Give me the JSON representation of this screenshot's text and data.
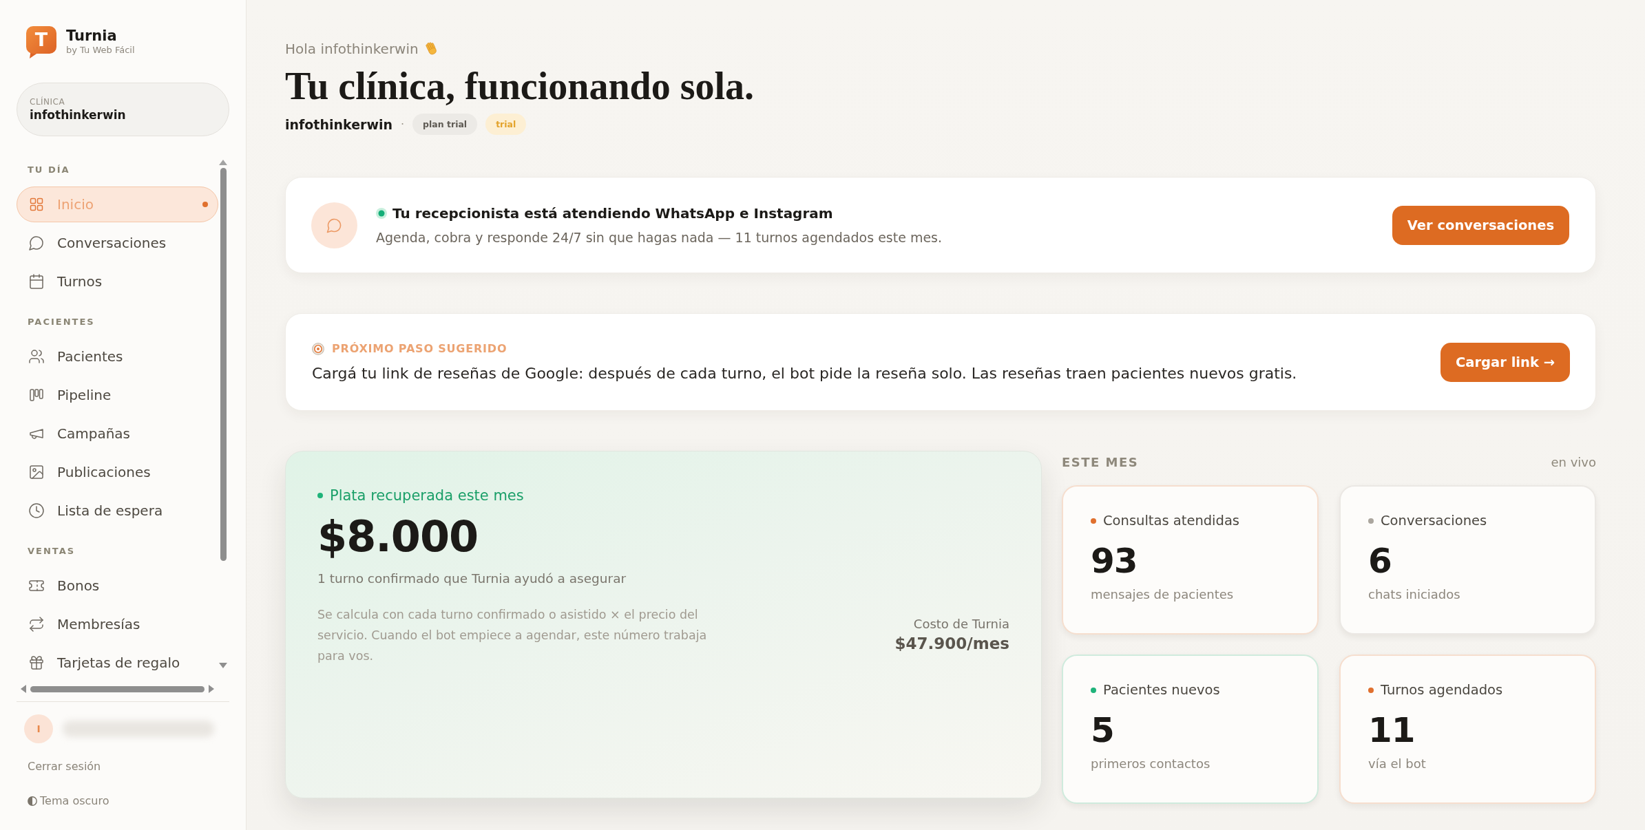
{
  "sidebar": {
    "brand": {
      "logo_letter": "T",
      "name": "Turnia",
      "tagline": "by Tu Web Fácil"
    },
    "clinic": {
      "label": "CLÍNICA",
      "name": "infothinkerwin"
    },
    "sections": [
      {
        "title": "TU DÍA",
        "items": [
          {
            "label": "Inicio",
            "selected": true
          },
          {
            "label": "Conversaciones",
            "selected": false
          },
          {
            "label": "Turnos",
            "selected": false
          }
        ]
      },
      {
        "title": "PACIENTES",
        "items": [
          {
            "label": "Pacientes",
            "selected": false
          },
          {
            "label": "Pipeline",
            "selected": false
          },
          {
            "label": "Campañas",
            "selected": false
          },
          {
            "label": "Publicaciones",
            "selected": false
          },
          {
            "label": "Lista de espera",
            "selected": false
          }
        ]
      },
      {
        "title": "VENTAS",
        "items": [
          {
            "label": "Bonos",
            "selected": false
          },
          {
            "label": "Membresías",
            "selected": false
          },
          {
            "label": "Tarjetas de regalo",
            "selected": false
          }
        ]
      }
    ],
    "user": {
      "initial": "I"
    },
    "logout": "Cerrar sesión",
    "theme_toggle": "Tema oscuro"
  },
  "header": {
    "greeting": "Hola infothinkerwin",
    "title": "Tu clínica, funcionando sola.",
    "clinic_name": "infothinkerwin",
    "separator": "·",
    "badges": [
      {
        "label": "plan trial",
        "kind": "neutral"
      },
      {
        "label": "trial",
        "kind": "warning"
      }
    ]
  },
  "status_card": {
    "online": true,
    "title": "Tu recepcionista está atendiendo WhatsApp e Instagram",
    "description": "Agenda, cobra y responde 24/7 sin que hagas nada — 11 turnos agendados este mes.",
    "button": "Ver conversaciones"
  },
  "suggestion_card": {
    "label": "PRÓXIMO PASO SUGERIDO",
    "text": "Cargá tu link de reseñas de Google: después de cada turno, el bot pide la reseña solo. Las reseñas traen pacientes nuevos gratis.",
    "button": "Cargar link →"
  },
  "recovered_card": {
    "label": "Plata recuperada este mes",
    "amount": "$8.000",
    "detail": "1 turno confirmado que Turnia ayudó a asegurar",
    "note": "Se calcula con cada turno confirmado o asistido × el precio del servicio. Cuando el bot empiece a agendar, este número trabaja para vos.",
    "cost_label": "Costo de Turnia",
    "cost_value": "$47.900/mes"
  },
  "this_month": {
    "title": "ESTE MES",
    "live_label": "en vivo",
    "stats": [
      {
        "label": "Consultas atendidas",
        "value": "93",
        "caption": "mensajes de pacientes",
        "color": "#e0702e"
      },
      {
        "label": "Conversaciones",
        "value": "6",
        "caption": "chats iniciados",
        "color": "#aba69e"
      },
      {
        "label": "Pacientes nuevos",
        "value": "5",
        "caption": "primeros contactos",
        "color": "#1fb37a"
      },
      {
        "label": "Turnos agendados",
        "value": "11",
        "caption": "vía el bot",
        "color": "#e0702e"
      }
    ]
  }
}
